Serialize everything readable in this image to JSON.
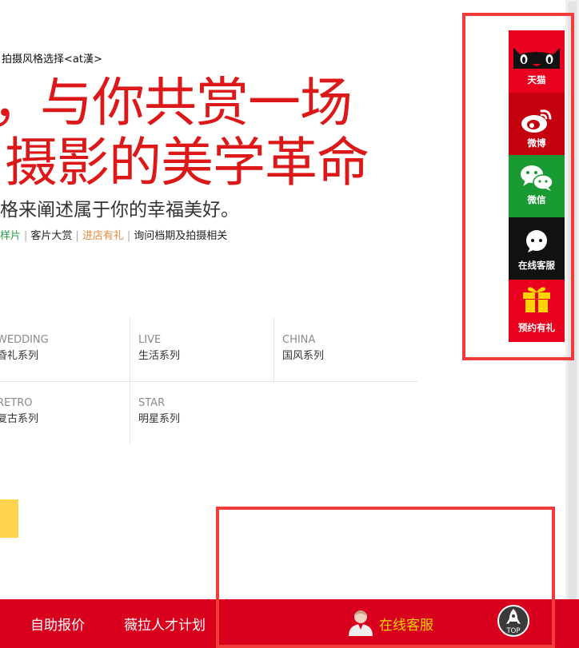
{
  "breadcrumb": "拍摄风格选择<at漢>",
  "hero": {
    "fragment": "，",
    "line1": "与你共赏一场",
    "line2": "摄影的美学革命",
    "subtitle": "格来阐述属于你的幸福美好。"
  },
  "links": [
    {
      "label": "样片",
      "color": "#2aa14a"
    },
    {
      "label": "客片大赏",
      "color": "#222222"
    },
    {
      "label": "进店有礼",
      "color": "#e98a3c"
    },
    {
      "label": "询问档期及拍摄相关",
      "color": "#222222"
    }
  ],
  "categories": [
    {
      "en": "WEDDING",
      "cn": "昏礼系列"
    },
    {
      "en": "LIVE",
      "cn": "生活系列"
    },
    {
      "en": "CHINA",
      "cn": "国风系列"
    },
    {
      "en": "RETRO",
      "cn": "复古系列"
    },
    {
      "en": "STAR",
      "cn": "明星系列"
    }
  ],
  "bottom_bar": {
    "item1": "自助报价",
    "item2": "薇拉人才计划",
    "customer_service": "在线客服",
    "top_label": "TOP"
  },
  "sidebar": [
    {
      "label": "天猫",
      "icon": "tmall-cat-icon",
      "bg": "#e8001e"
    },
    {
      "label": "微博",
      "icon": "weibo-icon",
      "bg": "#c4000f"
    },
    {
      "label": "微信",
      "icon": "wechat-icon",
      "bg": "#1a9a32"
    },
    {
      "label": "在线客服",
      "icon": "chat-bubble-icon",
      "bg": "#111111"
    },
    {
      "label": "预约有礼",
      "icon": "gift-icon",
      "bg": "#e8001e"
    }
  ],
  "colors": {
    "brand_red": "#d9001e",
    "headline_red": "#dc1818",
    "accent_yellow": "#ffd400",
    "annotation_red": "#f23c3c"
  }
}
